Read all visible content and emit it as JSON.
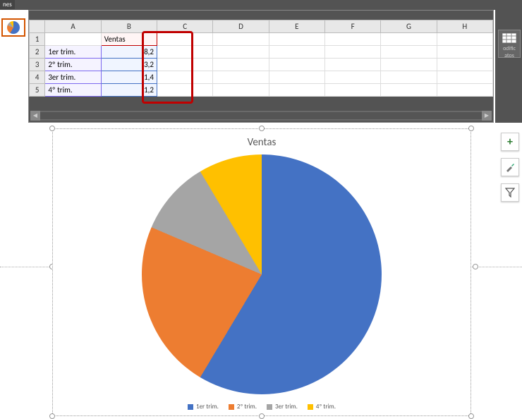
{
  "tab": "nes",
  "columns": [
    "A",
    "B",
    "C",
    "D",
    "E",
    "F",
    "G",
    "H"
  ],
  "rows": [
    "1",
    "2",
    "3",
    "4",
    "5"
  ],
  "header_label": "Ventas",
  "data_rows": [
    {
      "cat": "1er trim.",
      "val": "8,2"
    },
    {
      "cat": "2º trim.",
      "val": "3,2"
    },
    {
      "cat": "3er trim.",
      "val": "1,4"
    },
    {
      "cat": "4º trim.",
      "val": "1,2"
    }
  ],
  "right_label_1": "odific",
  "right_label_2": "atos",
  "chart_title": "Ventas",
  "legend": [
    "1er trim.",
    "2º trim.",
    "3er trim.",
    "4º trim."
  ],
  "colors": [
    "#4472C4",
    "#ED7D31",
    "#A5A5A5",
    "#FFC000"
  ],
  "chart_data": {
    "type": "pie",
    "title": "Ventas",
    "categories": [
      "1er trim.",
      "2º trim.",
      "3er trim.",
      "4º trim."
    ],
    "values": [
      8.2,
      3.2,
      1.4,
      1.2
    ],
    "series": [
      {
        "name": "Ventas",
        "values": [
          8.2,
          3.2,
          1.4,
          1.2
        ]
      }
    ],
    "legend_position": "bottom"
  }
}
